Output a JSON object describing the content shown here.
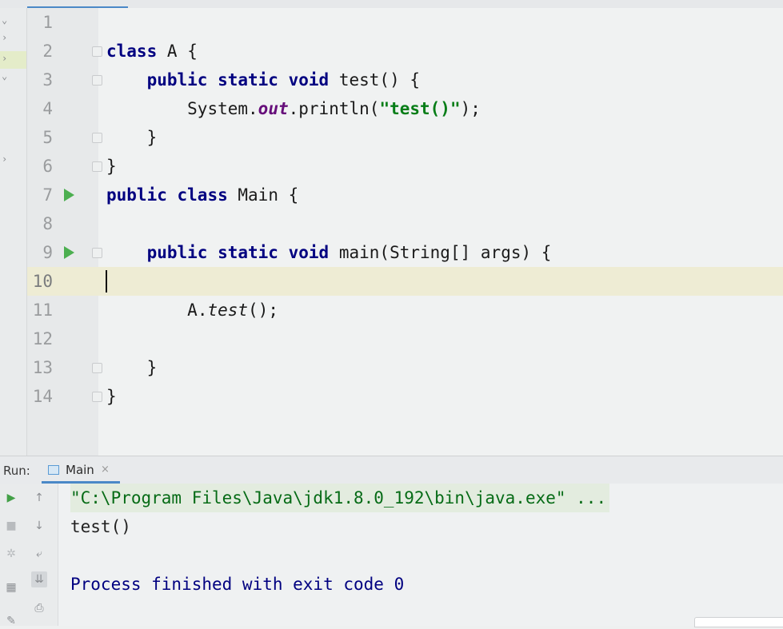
{
  "editor": {
    "lines": [
      {
        "num": "1",
        "text": ""
      },
      {
        "num": "2",
        "text": "class A {"
      },
      {
        "num": "3",
        "text": "    public static void test() {"
      },
      {
        "num": "4",
        "text": "        System.out.println(\"test()\");"
      },
      {
        "num": "5",
        "text": "    }"
      },
      {
        "num": "6",
        "text": "}"
      },
      {
        "num": "7",
        "text": "public class Main {"
      },
      {
        "num": "8",
        "text": ""
      },
      {
        "num": "9",
        "text": "    public static void main(String[] args) {"
      },
      {
        "num": "10",
        "text": ""
      },
      {
        "num": "11",
        "text": "        A.test();"
      },
      {
        "num": "12",
        "text": ""
      },
      {
        "num": "13",
        "text": "    }"
      },
      {
        "num": "14",
        "text": "}"
      }
    ],
    "current_line": "10"
  },
  "run": {
    "title": "Run:",
    "tab_label": "Main",
    "tab_close": "×",
    "console": {
      "command": "\"C:\\Program Files\\Java\\jdk1.8.0_192\\bin\\java.exe\" ...",
      "output": "test()",
      "exit": "Process finished with exit code 0"
    },
    "toolbar_icons": [
      "rerun-icon",
      "scroll-up-icon",
      "stop-icon",
      "scroll-down-icon",
      "debug-icon",
      "soft-wrap-icon",
      "layout-icon",
      "scroll-to-end-icon",
      "pin-icon",
      "print-icon"
    ]
  },
  "colors": {
    "keyword": "#000080",
    "string": "#067d17",
    "field": "#660e7a",
    "run_icon": "#4caf50",
    "tab_underline": "#4a88c7"
  }
}
